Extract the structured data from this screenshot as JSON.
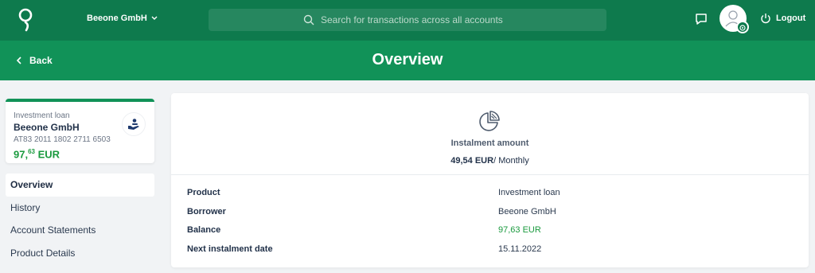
{
  "header": {
    "company": "Beeone GmbH",
    "search_placeholder": "Search for transactions across all accounts",
    "logout_label": "Logout"
  },
  "subheader": {
    "back_label": "Back",
    "title": "Overview"
  },
  "account_card": {
    "type": "Investment loan",
    "name": "Beeone GmbH",
    "iban": "AT83 2011 1802 2711 6503",
    "amount_main": "97,",
    "amount_cents": "63",
    "currency": "EUR"
  },
  "nav": {
    "items": [
      {
        "label": "Overview",
        "active": true
      },
      {
        "label": "History"
      },
      {
        "label": "Account Statements"
      },
      {
        "label": "Product Details"
      }
    ]
  },
  "instalment": {
    "label": "Instalment amount",
    "amount": "49,54 EUR",
    "frequency": "/ Monthly"
  },
  "details": [
    {
      "key": "Product",
      "value": "Investment loan"
    },
    {
      "key": "Borrower",
      "value": "Beeone GmbH"
    },
    {
      "key": "Balance",
      "value": "97,63 EUR"
    },
    {
      "key": "Next instalment date",
      "value": "15.11.2022"
    }
  ],
  "colors": {
    "brand_dark": "#0e7a4d",
    "brand": "#119258",
    "positive": "#1a9a3e"
  },
  "icons": [
    "logo-icon",
    "chevron-down-icon",
    "search-icon",
    "chat-icon",
    "user-icon",
    "settings-badge-icon",
    "power-icon",
    "chevron-left-icon",
    "loan-hand-icon",
    "pie-chart-icon"
  ]
}
